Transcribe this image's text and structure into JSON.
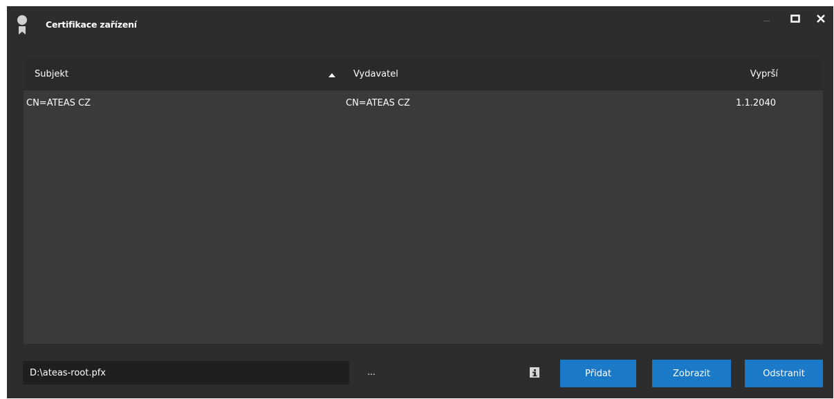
{
  "window": {
    "title": "Certifikace zařízení",
    "icons": {
      "app": "certificate-ribbon-icon",
      "minimize": "minimize-icon",
      "maximize": "maximize-icon",
      "close": "close-icon"
    }
  },
  "grid": {
    "columns": {
      "subjekt": "Subjekt",
      "vydavatel": "Vydavatel",
      "vyprsi": "Vyprší"
    },
    "sort": {
      "column": "subjekt",
      "direction": "ascending"
    },
    "rows": [
      {
        "subjekt": "CN=ATEAS CZ",
        "vydavatel": "CN=ATEAS CZ",
        "vyprsi": "1.1.2040"
      }
    ]
  },
  "footer": {
    "path_value": "D:\\ateas-root.pfx",
    "browse_label": "...",
    "info_icon": "info-icon",
    "buttons": {
      "pridat": "Přidat",
      "zobrazit": "Zobrazit",
      "odstranit": "Odstranit"
    }
  },
  "colors": {
    "background": "#2d2d2d",
    "grid": "#3a3a3a",
    "header": "#2a2a2a",
    "accent": "#1b7ac7"
  }
}
